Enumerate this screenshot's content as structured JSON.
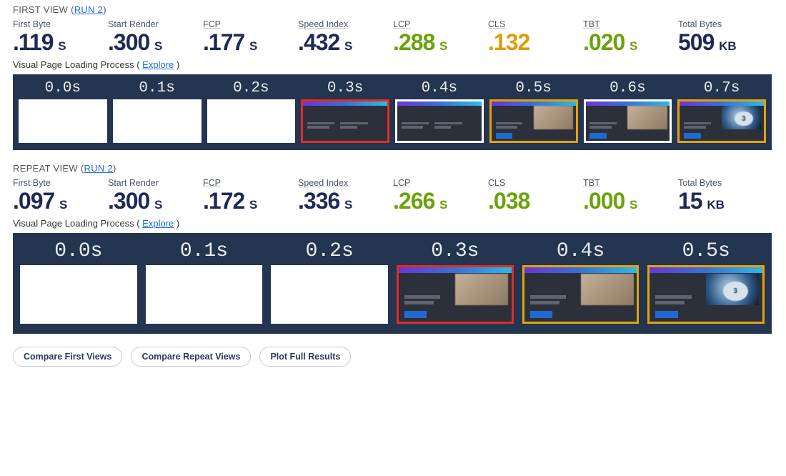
{
  "first_view": {
    "title": "FIRST VIEW",
    "run_link": "RUN 2",
    "metrics": {
      "first_byte": {
        "label": "First Byte",
        "value": ".119",
        "unit": "S",
        "color": ""
      },
      "start_render": {
        "label": "Start Render",
        "value": ".300",
        "unit": "S",
        "color": ""
      },
      "fcp": {
        "label": "FCP",
        "value": ".177",
        "unit": "S",
        "color": ""
      },
      "speed_index": {
        "label": "Speed Index",
        "value": ".432",
        "unit": "S",
        "color": ""
      },
      "lcp": {
        "label": "LCP",
        "value": ".288",
        "unit": "S",
        "color": "green"
      },
      "cls": {
        "label": "CLS",
        "value": ".132",
        "unit": "",
        "color": "orange"
      },
      "tbt": {
        "label": "TBT",
        "value": ".020",
        "unit": "S",
        "color": "green"
      },
      "total_bytes": {
        "label": "Total Bytes",
        "value": "509",
        "unit": "KB",
        "color": ""
      }
    },
    "visual_label": "Visual Page Loading Process",
    "explore": "Explore",
    "frames": [
      {
        "t": "0.0s",
        "kind": "blank"
      },
      {
        "t": "0.1s",
        "kind": "blank"
      },
      {
        "t": "0.2s",
        "kind": "blank"
      },
      {
        "t": "0.3s",
        "kind": "dark-text",
        "border": "red"
      },
      {
        "t": "0.4s",
        "kind": "dark-text",
        "border": ""
      },
      {
        "t": "0.5s",
        "kind": "partial-img",
        "border": "orange"
      },
      {
        "t": "0.6s",
        "kind": "partial-img",
        "border": ""
      },
      {
        "t": "0.7s",
        "kind": "full-img",
        "border": "orange"
      }
    ]
  },
  "repeat_view": {
    "title": "REPEAT VIEW",
    "run_link": "RUN 2",
    "metrics": {
      "first_byte": {
        "label": "First Byte",
        "value": ".097",
        "unit": "S",
        "color": ""
      },
      "start_render": {
        "label": "Start Render",
        "value": ".300",
        "unit": "S",
        "color": ""
      },
      "fcp": {
        "label": "FCP",
        "value": ".172",
        "unit": "S",
        "color": ""
      },
      "speed_index": {
        "label": "Speed Index",
        "value": ".336",
        "unit": "S",
        "color": ""
      },
      "lcp": {
        "label": "LCP",
        "value": ".266",
        "unit": "S",
        "color": "green"
      },
      "cls": {
        "label": "CLS",
        "value": ".038",
        "unit": "",
        "color": "green"
      },
      "tbt": {
        "label": "TBT",
        "value": ".000",
        "unit": "S",
        "color": "green"
      },
      "total_bytes": {
        "label": "Total Bytes",
        "value": "15",
        "unit": "KB",
        "color": ""
      }
    },
    "visual_label": "Visual Page Loading Process",
    "explore": "Explore",
    "frames": [
      {
        "t": "0.0s",
        "kind": "blank"
      },
      {
        "t": "0.1s",
        "kind": "blank"
      },
      {
        "t": "0.2s",
        "kind": "blank"
      },
      {
        "t": "0.3s",
        "kind": "partial-img",
        "border": "red"
      },
      {
        "t": "0.4s",
        "kind": "partial-img",
        "border": "orange"
      },
      {
        "t": "0.5s",
        "kind": "full-img",
        "border": "orange"
      }
    ]
  },
  "buttons": {
    "compare_first": "Compare First Views",
    "compare_repeat": "Compare Repeat Views",
    "plot": "Plot Full Results"
  }
}
